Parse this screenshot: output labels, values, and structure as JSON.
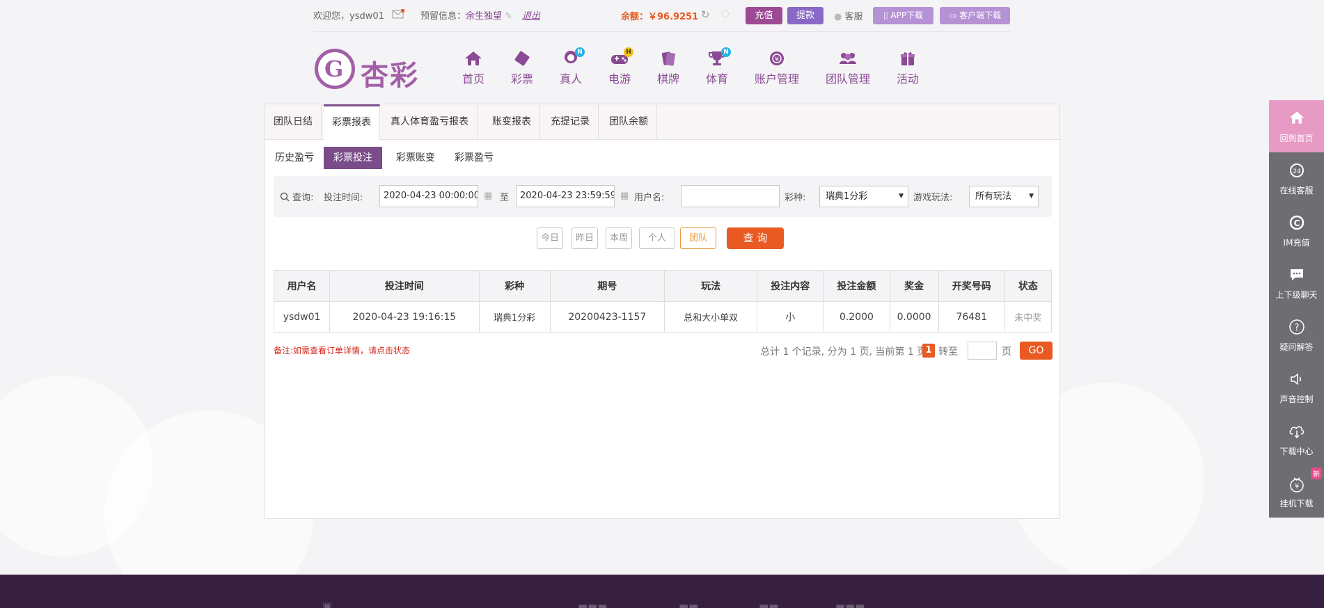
{
  "topbar": {
    "welcome": "欢迎您，ysdw01",
    "reserve_label": "预留信息：",
    "reserve_value": "余生独望",
    "logout": "退出",
    "balance": "余额：￥96.9251",
    "recharge": "充值",
    "withdraw": "提款",
    "service": "客服",
    "app_download": "APP下载",
    "client_download": "客户端下载"
  },
  "logo": {
    "mark": "G",
    "name": "杏彩"
  },
  "nav": [
    {
      "label": "首页",
      "icon": "home-icon"
    },
    {
      "label": "彩票",
      "icon": "ticket-icon"
    },
    {
      "label": "真人",
      "icon": "live-dealer-icon",
      "badge": "N"
    },
    {
      "label": "电游",
      "icon": "gamepad-icon",
      "badge": "H"
    },
    {
      "label": "棋牌",
      "icon": "cards-icon"
    },
    {
      "label": "体育",
      "icon": "trophy-icon",
      "badge": "N"
    },
    {
      "label": "账户管理",
      "icon": "account-icon"
    },
    {
      "label": "团队管理",
      "icon": "team-icon"
    },
    {
      "label": "活动",
      "icon": "gift-icon"
    }
  ],
  "tabs_main": [
    "团队日结",
    "彩票报表",
    "真人体育盈亏报表",
    "账变报表",
    "充提记录",
    "团队余额"
  ],
  "tabs_sub": [
    "历史盈亏",
    "彩票投注",
    "彩票账变",
    "彩票盈亏"
  ],
  "search": {
    "query_label": "查询:",
    "time_label": "投注时间:",
    "start_time": "2020-04-23 00:00:00",
    "to": "至",
    "end_time": "2020-04-23 23:59:59",
    "username_label": "用户名:",
    "username_value": "",
    "lottery_label": "彩种:",
    "lottery_value": "瑞典1分彩",
    "play_label": "游戏玩法:",
    "play_value": "所有玩法"
  },
  "quick_buttons": {
    "today": "今日",
    "yesterday": "昨日",
    "week": "本周",
    "personal": "个人",
    "team": "团队",
    "query": "查 询"
  },
  "table": {
    "headers": [
      "用户名",
      "投注时间",
      "彩种",
      "期号",
      "玩法",
      "投注内容",
      "投注金额",
      "奖金",
      "开奖号码",
      "状态"
    ],
    "rows": [
      [
        "ysdw01",
        "2020-04-23 19:16:15",
        "瑞典1分彩",
        "20200423-1157",
        "总和大小单双",
        "小",
        "0.2000",
        "0.0000",
        "76481",
        "未中奖"
      ]
    ]
  },
  "note": "备注:如需查看订单详情，请点击状态",
  "pager": {
    "summary": "总计 1 个记录, 分为 1 页, 当前第 1 页",
    "current": "1",
    "goto_label": "转至",
    "page_unit": "页",
    "go": "GO"
  },
  "sidebar": [
    {
      "label": "回到首页",
      "icon": "home-icon"
    },
    {
      "label": "在线客服",
      "icon": "headset-icon"
    },
    {
      "label": "IM充值",
      "icon": "im-recharge-icon"
    },
    {
      "label": "上下级聊天",
      "icon": "chat-icon"
    },
    {
      "label": "疑问解答",
      "icon": "question-icon"
    },
    {
      "label": "声音控制",
      "icon": "speaker-icon"
    },
    {
      "label": "下载中心",
      "icon": "cloud-download-icon"
    },
    {
      "label": "挂机下载",
      "icon": "money-bag-icon",
      "badge": "新"
    }
  ],
  "colors": {
    "brand": "#7b4c8a",
    "accent": "#e85a22",
    "sidebar": "#6e6e72",
    "footer": "#37203f"
  }
}
